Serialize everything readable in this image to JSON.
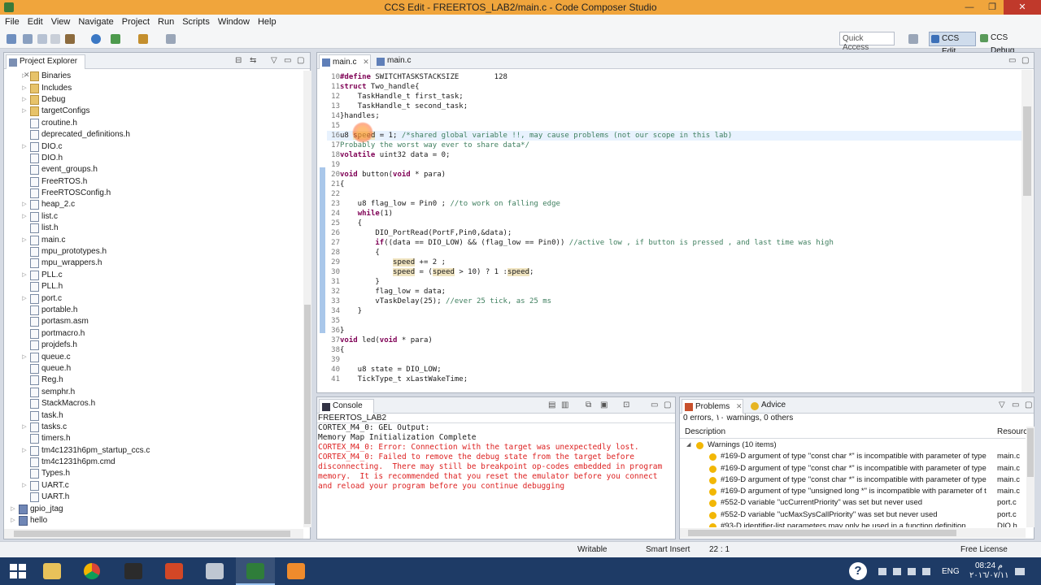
{
  "window": {
    "title": "CCS Edit - FREERTOS_LAB2/main.c - Code Composer Studio",
    "controls": [
      "—",
      "❐",
      "✕"
    ]
  },
  "menu": [
    "File",
    "Edit",
    "View",
    "Navigate",
    "Project",
    "Run",
    "Scripts",
    "Window",
    "Help"
  ],
  "toolbar": {
    "quick_access_placeholder": "Quick Access",
    "perspective_edit": "CCS Edit",
    "perspective_debug": "CCS Debug"
  },
  "explorer": {
    "tab_label": "Project Explorer",
    "items": [
      {
        "label": "Binaries",
        "type": "folder",
        "indent": 1
      },
      {
        "label": "Includes",
        "type": "folder",
        "indent": 1
      },
      {
        "label": "Debug",
        "type": "folder",
        "indent": 1
      },
      {
        "label": "targetConfigs",
        "type": "folder",
        "indent": 1
      },
      {
        "label": "croutine.h",
        "type": "file",
        "indent": 1
      },
      {
        "label": "deprecated_definitions.h",
        "type": "file",
        "indent": 1
      },
      {
        "label": "DIO.c",
        "type": "file",
        "indent": 1
      },
      {
        "label": "DIO.h",
        "type": "file",
        "indent": 1
      },
      {
        "label": "event_groups.h",
        "type": "file",
        "indent": 1
      },
      {
        "label": "FreeRTOS.h",
        "type": "file",
        "indent": 1
      },
      {
        "label": "FreeRTOSConfig.h",
        "type": "file",
        "indent": 1
      },
      {
        "label": "heap_2.c",
        "type": "file",
        "indent": 1
      },
      {
        "label": "list.c",
        "type": "file",
        "indent": 1
      },
      {
        "label": "list.h",
        "type": "file",
        "indent": 1
      },
      {
        "label": "main.c",
        "type": "file",
        "indent": 1
      },
      {
        "label": "mpu_prototypes.h",
        "type": "file",
        "indent": 1
      },
      {
        "label": "mpu_wrappers.h",
        "type": "file",
        "indent": 1
      },
      {
        "label": "PLL.c",
        "type": "file",
        "indent": 1
      },
      {
        "label": "PLL.h",
        "type": "file",
        "indent": 1
      },
      {
        "label": "port.c",
        "type": "file",
        "indent": 1
      },
      {
        "label": "portable.h",
        "type": "file",
        "indent": 1
      },
      {
        "label": "portasm.asm",
        "type": "file",
        "indent": 1
      },
      {
        "label": "portmacro.h",
        "type": "file",
        "indent": 1
      },
      {
        "label": "projdefs.h",
        "type": "file",
        "indent": 1
      },
      {
        "label": "queue.c",
        "type": "file",
        "indent": 1
      },
      {
        "label": "queue.h",
        "type": "file",
        "indent": 1
      },
      {
        "label": "Reg.h",
        "type": "file",
        "indent": 1
      },
      {
        "label": "semphr.h",
        "type": "file",
        "indent": 1
      },
      {
        "label": "StackMacros.h",
        "type": "file",
        "indent": 1
      },
      {
        "label": "task.h",
        "type": "file",
        "indent": 1
      },
      {
        "label": "tasks.c",
        "type": "file",
        "indent": 1
      },
      {
        "label": "timers.h",
        "type": "file",
        "indent": 1
      },
      {
        "label": "tm4c1231h6pm_startup_ccs.c",
        "type": "file",
        "indent": 1
      },
      {
        "label": "tm4c1231h6pm.cmd",
        "type": "file",
        "indent": 1
      },
      {
        "label": "Types.h",
        "type": "file",
        "indent": 1
      },
      {
        "label": "UART.c",
        "type": "file",
        "indent": 1
      },
      {
        "label": "UART.h",
        "type": "file",
        "indent": 1
      },
      {
        "label": "gpio_jtag",
        "type": "project",
        "indent": 0
      },
      {
        "label": "hello",
        "type": "project",
        "indent": 0
      }
    ]
  },
  "editor": {
    "tabs": [
      "main.c",
      "main.c"
    ],
    "current_line": 16,
    "lines": [
      {
        "n": "10",
        "code": "#define SWITCHTASKSTACKSIZE        128"
      },
      {
        "n": "11",
        "code": "struct Two_handle{"
      },
      {
        "n": "12",
        "code": "    TaskHandle_t first_task;"
      },
      {
        "n": "13",
        "code": "    TaskHandle_t second_task;"
      },
      {
        "n": "14",
        "code": "}handles;"
      },
      {
        "n": "15",
        "code": ""
      },
      {
        "n": "16",
        "code": "u8 speed = 1; /*shared global variable !!, may cause problems (not our scope in this lab)"
      },
      {
        "n": "17",
        "code": "Probably the worst way ever to share data*/"
      },
      {
        "n": "18",
        "code": "volatile uint32 data = 0;"
      },
      {
        "n": "19",
        "code": ""
      },
      {
        "n": "20",
        "code": "void button(void * para)"
      },
      {
        "n": "21",
        "code": "{"
      },
      {
        "n": "22",
        "code": ""
      },
      {
        "n": "23",
        "code": "    u8 flag_low = Pin0 ; //to work on falling edge"
      },
      {
        "n": "24",
        "code": "    while(1)"
      },
      {
        "n": "25",
        "code": "    {"
      },
      {
        "n": "26",
        "code": "        DIO_PortRead(PortF,Pin0,&data);"
      },
      {
        "n": "27",
        "code": "        if((data == DIO_LOW) && (flag_low == Pin0)) //active low , if button is pressed , and last time was high"
      },
      {
        "n": "28",
        "code": "        {"
      },
      {
        "n": "29",
        "code": "            speed += 2 ;"
      },
      {
        "n": "30",
        "code": "            speed = (speed > 10) ? 1 :speed;"
      },
      {
        "n": "31",
        "code": "        }"
      },
      {
        "n": "32",
        "code": "        flag_low = data;"
      },
      {
        "n": "33",
        "code": "        vTaskDelay(25); //ever 25 tick, as 25 ms"
      },
      {
        "n": "34",
        "code": "    }"
      },
      {
        "n": "35",
        "code": ""
      },
      {
        "n": "36",
        "code": "}"
      },
      {
        "n": "37",
        "code": "void led(void * para)"
      },
      {
        "n": "38",
        "code": "{"
      },
      {
        "n": "39",
        "code": ""
      },
      {
        "n": "40",
        "code": "    u8 state = DIO_LOW;"
      },
      {
        "n": "41",
        "code": "    TickType_t xLastWakeTime;"
      }
    ]
  },
  "console": {
    "tab_label": "Console",
    "title": "FREERTOS_LAB2",
    "lines": [
      {
        "text": "CORTEX_M4_0: GEL Output:",
        "error": false
      },
      {
        "text": "Memory Map Initialization Complete",
        "error": false
      },
      {
        "text": "CORTEX_M4_0: Error: Connection with the target was unexpectedly lost.",
        "error": true
      },
      {
        "text": "CORTEX_M4_0: Failed to remove the debug state from the target before",
        "error": true
      },
      {
        "text": "disconnecting.  There may still be breakpoint op-codes embedded in program",
        "error": true
      },
      {
        "text": "memory.  It is recommended that you reset the emulator before you connect",
        "error": true
      },
      {
        "text": "and reload your program before you continue debugging",
        "error": true
      }
    ]
  },
  "problems": {
    "tab_label": "Problems",
    "advice_tab": "Advice",
    "summary": "0 errors, ١٠ warnings, 0 others",
    "col_description": "Description",
    "col_resource": "Resource",
    "group": "Warnings (10 items)",
    "rows": [
      {
        "desc": "#169-D argument of type \"const char *\" is incompatible with parameter of type",
        "res": "main.c"
      },
      {
        "desc": "#169-D argument of type \"const char *\" is incompatible with parameter of type",
        "res": "main.c"
      },
      {
        "desc": "#169-D argument of type \"const char *\" is incompatible with parameter of type",
        "res": "main.c"
      },
      {
        "desc": "#169-D argument of type \"unsigned long *\" is incompatible with parameter of t",
        "res": "main.c"
      },
      {
        "desc": "#552-D variable \"ucCurrentPriority\" was set but never used",
        "res": "port.c"
      },
      {
        "desc": "#552-D variable \"ucMaxSysCallPriority\" was set but never used",
        "res": "port.c"
      },
      {
        "desc": "#93-D identifier-list parameters may only be used in a function definition",
        "res": "DIO.h"
      }
    ]
  },
  "status": {
    "writable": "Writable",
    "insert_mode": "Smart Insert",
    "position": "22 : 1",
    "license": "Free License"
  },
  "taskbar": {
    "apps": [
      "file-explorer",
      "chrome",
      "app-dark",
      "powerpoint",
      "virtualbox",
      "ccs",
      "sublime"
    ],
    "lang": "ENG",
    "time": "08:24 م",
    "date": "٢٠١٦/٠٧/١١"
  }
}
